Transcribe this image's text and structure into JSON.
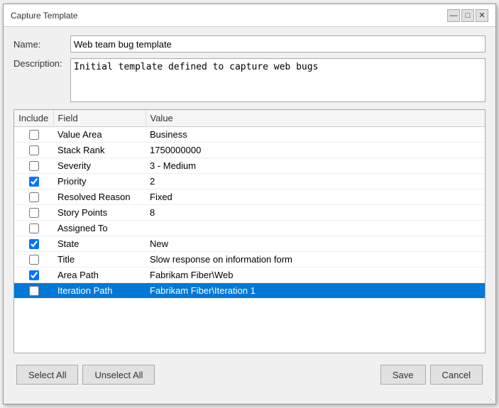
{
  "window": {
    "title": "Capture Template"
  },
  "titlebar_controls": {
    "minimize": "—",
    "maximize": "□",
    "close": "✕"
  },
  "form": {
    "name_label": "Name:",
    "name_value": "Web team bug template",
    "description_label": "Description:",
    "description_value": "Initial template defined to capture web bugs"
  },
  "table": {
    "headers": [
      "Include",
      "Field",
      "Value"
    ],
    "rows": [
      {
        "checked": false,
        "field": "Value Area",
        "value": "Business"
      },
      {
        "checked": false,
        "field": "Stack Rank",
        "value": "1750000000"
      },
      {
        "checked": false,
        "field": "Severity",
        "value": "3 - Medium"
      },
      {
        "checked": true,
        "field": "Priority",
        "value": "2"
      },
      {
        "checked": false,
        "field": "Resolved Reason",
        "value": "Fixed"
      },
      {
        "checked": false,
        "field": "Story Points",
        "value": "8"
      },
      {
        "checked": false,
        "field": "Assigned To",
        "value": ""
      },
      {
        "checked": true,
        "field": "State",
        "value": "New"
      },
      {
        "checked": false,
        "field": "Title",
        "value": "Slow response on information form"
      },
      {
        "checked": true,
        "field": "Area Path",
        "value": "Fabrikam Fiber\\Web"
      },
      {
        "checked": false,
        "field": "Iteration Path",
        "value": "Fabrikam Fiber\\Iteration 1",
        "selected": true
      }
    ]
  },
  "footer": {
    "select_all": "Select All",
    "unselect_all": "Unselect All",
    "save": "Save",
    "cancel": "Cancel"
  }
}
